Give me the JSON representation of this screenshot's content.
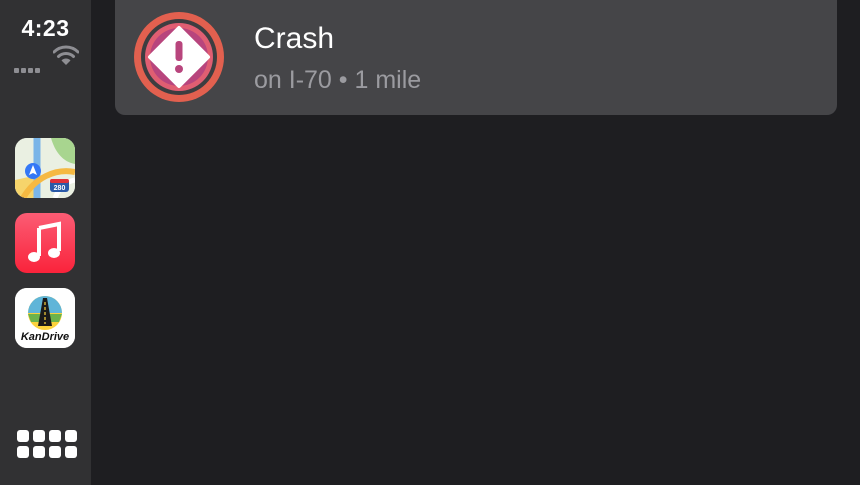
{
  "status": {
    "time": "4:23",
    "signal_icon": "cellular-signal-icon",
    "wifi_icon": "wifi-icon"
  },
  "sidebar": {
    "apps": [
      {
        "name": "Maps",
        "icon": "maps-app-icon",
        "badge_text": "280"
      },
      {
        "name": "Music",
        "icon": "music-app-icon"
      },
      {
        "name": "KanDrive",
        "icon": "kandrive-app-icon",
        "logo_text": "KanDrive"
      }
    ],
    "home_icon": "app-grid-icon"
  },
  "alert": {
    "title": "Crash",
    "subtitle": "on I-70 • 1 mile",
    "icon": "warning-icon",
    "colors": {
      "ring_outer": "#e2604f",
      "ring_inner": "#b8457d",
      "diamond": "#ffffff"
    }
  },
  "colors": {
    "sidebar_bg": "#313133",
    "main_bg": "#1e1e21",
    "card_bg": "#454548",
    "subtitle": "#9b9ba0"
  }
}
